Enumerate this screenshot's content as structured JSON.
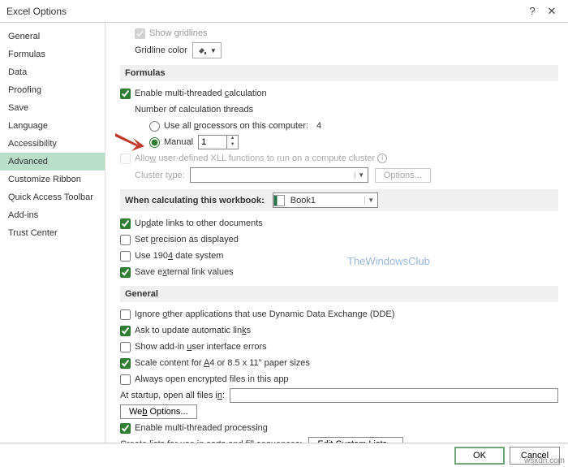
{
  "titlebar": {
    "title": "Excel Options"
  },
  "sidebar": {
    "items": [
      "General",
      "Formulas",
      "Data",
      "Proofing",
      "Save",
      "Language",
      "Accessibility",
      "Advanced",
      "Customize Ribbon",
      "Quick Access Toolbar",
      "Add-ins",
      "Trust Center"
    ],
    "selected_index": 7
  },
  "top": {
    "show_gridlines": "Show gridlines",
    "gridline_color": "Gridline color"
  },
  "formulas": {
    "header": "Formulas",
    "enable_multithread": "Enable multi-threaded calculation",
    "num_threads": "Number of calculation threads",
    "use_all": "Use all processors on this computer:",
    "use_all_count": "4",
    "manual": "Manual",
    "manual_value": "1",
    "allow_xll": "Allow user-defined XLL functions to run on a compute cluster",
    "cluster_type": "Cluster type:",
    "options_btn": "Options..."
  },
  "when_calc": {
    "header_prefix": "When calculatin",
    "header_g": "g",
    "header_suffix": " this workbook:",
    "workbook": "Book1",
    "update_links": "Update links to other documents",
    "precision": "Set precision as displayed",
    "date1904": "Use 1904 date system",
    "save_external": "Save external link values"
  },
  "general": {
    "header": "General",
    "ignore_dde": "Ignore other applications that use Dynamic Data Exchange (DDE)",
    "ask_links": "Ask to update automatic links",
    "addin_errors": "Show add-in user interface errors",
    "scale_content": "Scale content for A4 or 8.5 x 11\" paper sizes",
    "always_encrypted": "Always open encrypted files in this app",
    "at_startup": "At startup, open all files in:",
    "web_options": "Web Options...",
    "enable_mt_processing": "Enable multi-threaded processing",
    "create_lists": "Create lists for use in sorts and fill sequences:",
    "edit_custom_lists": "Edit Custom Lists..."
  },
  "footer": {
    "ok": "OK",
    "cancel": "Cancel"
  },
  "watermark": "TheWindowsClub",
  "sitemark": "wsxdn.com"
}
